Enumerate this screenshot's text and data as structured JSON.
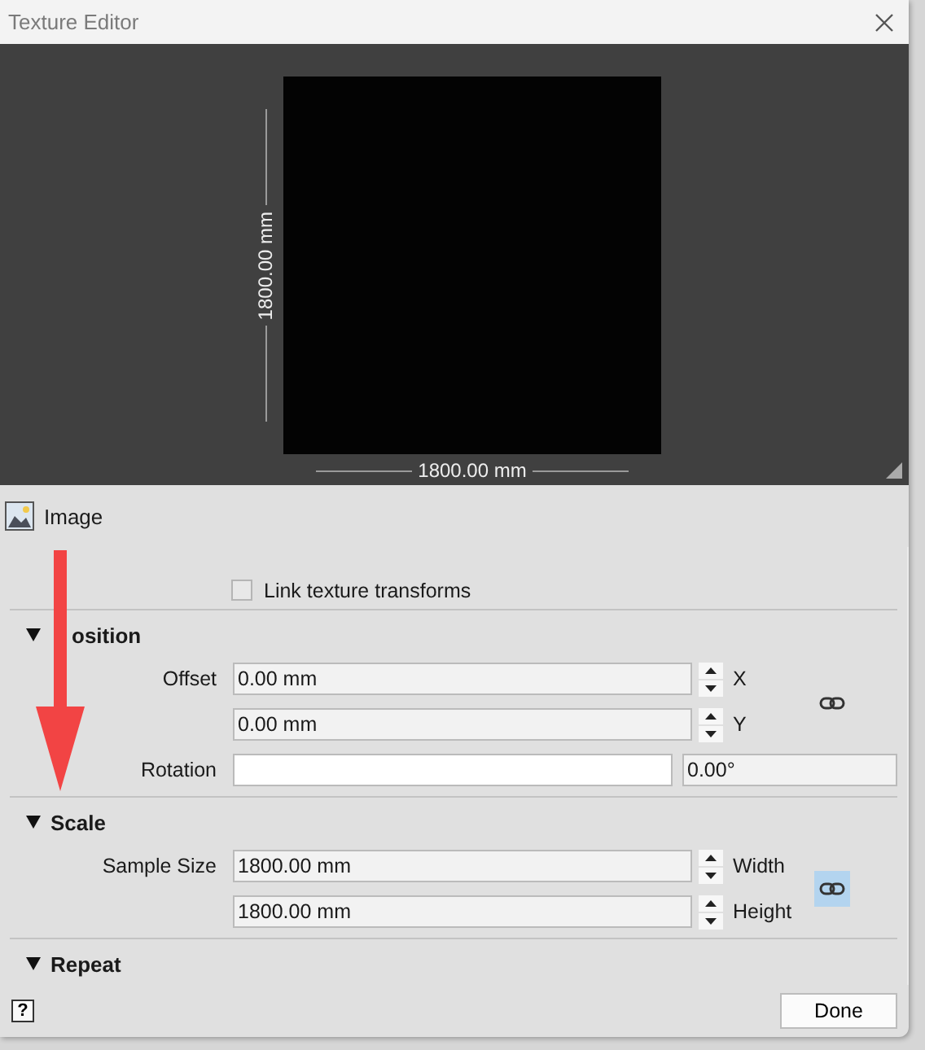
{
  "window": {
    "title": "Texture Editor"
  },
  "preview": {
    "width_label": "1800.00 mm",
    "height_label": "1800.00 mm"
  },
  "image_row": {
    "label": "Image"
  },
  "link_transforms": {
    "label": "Link texture transforms",
    "checked": false
  },
  "sections": [
    {
      "title": "osition",
      "expanded": true,
      "linked": false,
      "rows": [
        {
          "kind": "spin",
          "label": "Offset",
          "value": "0.00 mm",
          "axis": "X"
        },
        {
          "kind": "spin",
          "value": "0.00 mm",
          "axis": "Y"
        },
        {
          "kind": "angle",
          "label": "Rotation",
          "reading": "0.00°"
        }
      ]
    },
    {
      "title": "Scale",
      "expanded": true,
      "linked": true,
      "rows": [
        {
          "kind": "spin",
          "label": "Sample Size",
          "value": "1800.00 mm",
          "axis": "Width"
        },
        {
          "kind": "spin",
          "value": "1800.00 mm",
          "axis": "Height"
        }
      ]
    },
    {
      "title": "Repeat",
      "expanded": true
    }
  ],
  "footer": {
    "help": "?",
    "done": "Done"
  }
}
